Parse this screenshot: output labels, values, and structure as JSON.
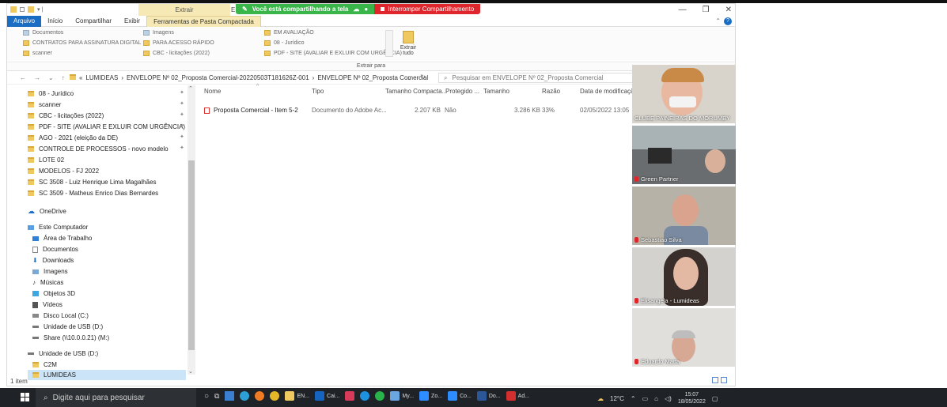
{
  "titlebar": {
    "context_tab": "Extrair",
    "window_title_prefix": "EN",
    "share_message": "Você está compartilhando a tela",
    "stop_share": "Interromper Compartilhamento"
  },
  "ribbon_tabs": [
    "Arquivo",
    "Início",
    "Compartilhar",
    "Exibir",
    "Ferramentas de Pasta Compactada"
  ],
  "ribbon": {
    "col1": [
      "Documentos",
      "CONTRATOS PARA ASSINATURA DIGITAL",
      "scanner"
    ],
    "col2": [
      "Imagens",
      "PARA ACESSO RÁPIDO",
      "CBC - licitações (2022)"
    ],
    "col3": [
      "EM AVALIAÇÃO",
      "08 - Jurídico",
      "PDF - SITE (AVALIAR E EXLUIR COM URGÊNCIA)"
    ],
    "extract_all": "Extrair tudo",
    "group_label": "Extrair para"
  },
  "address": {
    "crumbs": [
      "«",
      "LUMIDEAS",
      "›",
      "ENVELOPE Nº 02_Proposta Comercial-20220503T181626Z-001",
      "›",
      "ENVELOPE Nº 02_Proposta Comercial"
    ],
    "search_placeholder": "Pesquisar em ENVELOPE Nº 02_Proposta Comercial"
  },
  "nav": {
    "quick": [
      "08 - Jurídico",
      "scanner",
      "CBC - licitações (2022)",
      "PDF - SITE (AVALIAR E EXLUIR COM URGÊNCIA)",
      "AGO - 2021 (eleição da DE)",
      "CONTROLE DE PROCESSOS - novo modelo",
      "LOTE 02",
      "MODELOS - FJ 2022",
      "SC 3508 - Luiz Henrique Lima Magalhães",
      "SC 3509 - Matheus Enrico Dias Bernardes"
    ],
    "onedrive": "OneDrive",
    "this_pc": "Este Computador",
    "pc_items": [
      "Área de Trabalho",
      "Documentos",
      "Downloads",
      "Imagens",
      "Músicas",
      "Objetos 3D",
      "Vídeos",
      "Disco Local (C:)",
      "Unidade de USB (D:)",
      "Share (\\\\10.0.0.21) (M:)"
    ],
    "usb": "Unidade de USB (D:)",
    "usb_items": [
      "C2M",
      "LUMIDEAS"
    ]
  },
  "columns": [
    "Nome",
    "Tipo",
    "Tamanho Compacta...",
    "Protegido ...",
    "Tamanho",
    "Razão",
    "Data de modificação"
  ],
  "file": {
    "name": "Proposta Comercial - Item 5-2",
    "type": "Documento do Adobe Ac...",
    "compressed": "2.207 KB",
    "protected": "Não",
    "size": "3.286 KB",
    "ratio": "33%",
    "modified": "02/05/2022 13:05"
  },
  "status": "1 item",
  "participants": [
    {
      "name": "CLUBE PAINEIRAS DO MORUMBY"
    },
    {
      "name": "Green Partner"
    },
    {
      "name": "Sebastiao Silva"
    },
    {
      "name": "Elisangela - Lumideas"
    },
    {
      "name": "Eduardo Matta"
    }
  ],
  "taskbar": {
    "search_placeholder": "Digite aqui para pesquisar",
    "apps": [
      "EN...",
      "Cai...",
      "My...",
      "Zo...",
      "Co...",
      "Do...",
      "Ad..."
    ],
    "weather": "12°C",
    "time": "15:07",
    "date": "18/05/2022"
  }
}
